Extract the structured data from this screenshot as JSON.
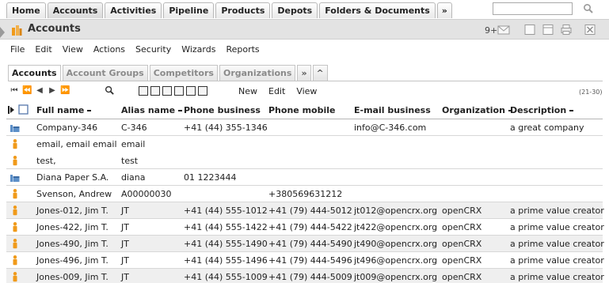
{
  "top_tabs": [
    "Home",
    "Accounts",
    "Activities",
    "Pipeline",
    "Products",
    "Depots",
    "Folders & Documents",
    "»"
  ],
  "search": {
    "placeholder": ""
  },
  "header": {
    "title": "Accounts",
    "notifications": "9+"
  },
  "menu": [
    "File",
    "Edit",
    "View",
    "Actions",
    "Security",
    "Wizards",
    "Reports"
  ],
  "sub_tabs": [
    "Accounts",
    "Account Groups",
    "Competitors",
    "Organizations",
    "»",
    "^"
  ],
  "grid_menu": [
    "New",
    "Edit",
    "View"
  ],
  "range": "(21-30)",
  "columns": [
    "Full name",
    "Alias name",
    "Phone business",
    "Phone mobile",
    "E-mail business",
    "Organization",
    "Description"
  ],
  "rows": [
    {
      "type": "group",
      "full_name": "Company-346",
      "alias": "C-346",
      "phone": "+41 (44) 355-1346",
      "mobile": "",
      "email": "info@C-346.com",
      "org": "",
      "desc": "a great company"
    },
    {
      "type": "person",
      "full_name": "email, email email",
      "alias": "email",
      "phone": "",
      "mobile": "",
      "email": "",
      "org": "",
      "desc": ""
    },
    {
      "type": "person",
      "full_name": "test,",
      "alias": "test",
      "phone": "",
      "mobile": "",
      "email": "",
      "org": "",
      "desc": ""
    },
    {
      "type": "group",
      "full_name": "Diana Paper S.A.",
      "alias": "diana",
      "phone": "01 1223444",
      "mobile": "",
      "email": "",
      "org": "",
      "desc": ""
    },
    {
      "type": "person",
      "full_name": "Svenson, Andrew",
      "alias": "A00000030",
      "phone": "",
      "mobile": "+380569631212",
      "email": "",
      "org": "",
      "desc": ""
    },
    {
      "type": "person",
      "full_name": "Jones-012, Jim T.",
      "alias": "JT",
      "phone": "+41 (44) 555-1012",
      "mobile": "+41 (79) 444-5012",
      "email": "jt012@opencrx.org",
      "org": "openCRX",
      "desc": "a prime value creator"
    },
    {
      "type": "person",
      "full_name": "Jones-422, Jim T.",
      "alias": "JT",
      "phone": "+41 (44) 555-1422",
      "mobile": "+41 (79) 444-5422",
      "email": "jt422@opencrx.org",
      "org": "openCRX",
      "desc": "a prime value creator"
    },
    {
      "type": "person",
      "full_name": "Jones-490, Jim T.",
      "alias": "JT",
      "phone": "+41 (44) 555-1490",
      "mobile": "+41 (79) 444-5490",
      "email": "jt490@opencrx.org",
      "org": "openCRX",
      "desc": "a prime value creator"
    },
    {
      "type": "person",
      "full_name": "Jones-496, Jim T.",
      "alias": "JT",
      "phone": "+41 (44) 555-1496",
      "mobile": "+41 (79) 444-5496",
      "email": "jt496@opencrx.org",
      "org": "openCRX",
      "desc": "a prime value creator"
    },
    {
      "type": "person",
      "full_name": "Jones-009, Jim T.",
      "alias": "JT",
      "phone": "+41 (44) 555-1009",
      "mobile": "+41 (79) 444-5009",
      "email": "jt009@opencrx.org",
      "org": "openCRX",
      "desc": "a prime value creator"
    }
  ],
  "colors": {
    "accent_orange": "#f09a1a",
    "company_blue": "#5c8fc8",
    "header_bg": "#e3e3e3",
    "row_alt": "#efefef"
  }
}
